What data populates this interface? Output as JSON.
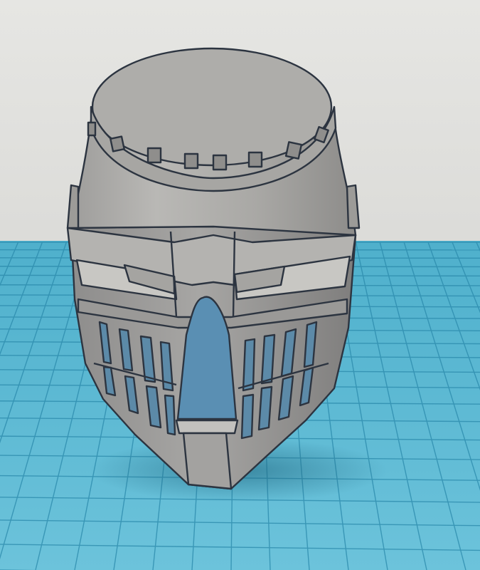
{
  "viewport": {
    "background_color": "#dcdcd9",
    "grid_color": "#5fb8d0",
    "grid_line_color": "#2d8fb0",
    "model_color": "#b5b4b2",
    "edge_color": "#2c3440"
  },
  "model": {
    "name": "",
    "shape": "great-helm"
  }
}
